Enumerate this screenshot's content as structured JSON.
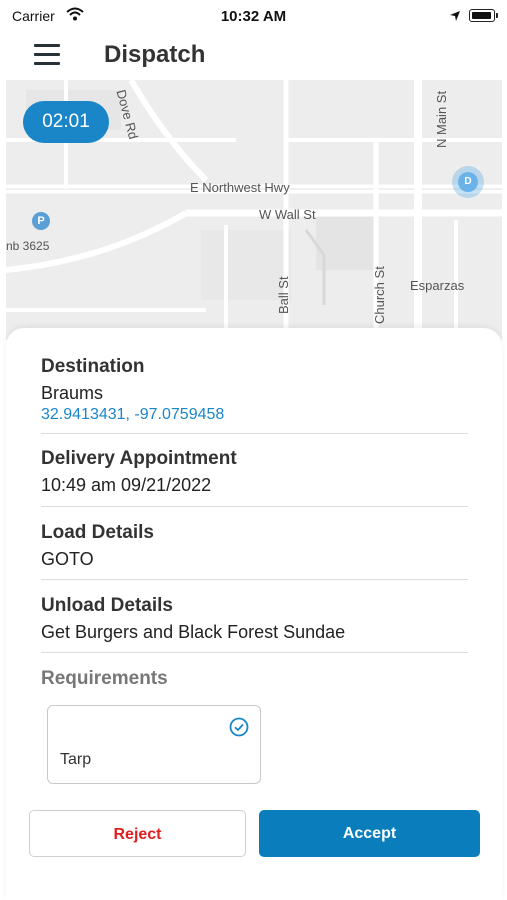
{
  "status_bar": {
    "carrier": "Carrier",
    "time": "10:32 AM",
    "icons": [
      "wifi-icon",
      "location-arrow-icon",
      "battery-icon"
    ]
  },
  "nav": {
    "title": "Dispatch",
    "menu_icon": "hamburger-menu-icon"
  },
  "map": {
    "timer": "02:01",
    "parking_marker": "P",
    "destination_marker": "D",
    "street_labels": {
      "dove_rd": "Dove Rd",
      "n_main_st": "N Main St",
      "e_northwest_hwy": "E Northwest Hwy",
      "w_wall_st": "W Wall St",
      "ball_st": "Ball St",
      "church_st": "Church St",
      "esparzas": "Esparzas",
      "poi_partial": "nb 3625"
    }
  },
  "details": {
    "destination": {
      "heading": "Destination",
      "name": "Braums",
      "coordinates": "32.9413431, -97.0759458"
    },
    "delivery_appointment": {
      "heading": "Delivery Appointment",
      "value": "10:49 am 09/21/2022"
    },
    "load_details": {
      "heading": "Load Details",
      "value": "GOTO"
    },
    "unload_details": {
      "heading": "Unload Details",
      "value": "Get Burgers and Black Forest Sundae"
    },
    "requirements": {
      "heading": "Requirements",
      "items": [
        {
          "label": "Tarp",
          "checked": true
        }
      ]
    }
  },
  "actions": {
    "reject_label": "Reject",
    "accept_label": "Accept"
  },
  "colors": {
    "accent_blue": "#1a86c8",
    "accept_button": "#0a7ebd",
    "reject_text": "#e02020",
    "map_background": "#efefef"
  }
}
